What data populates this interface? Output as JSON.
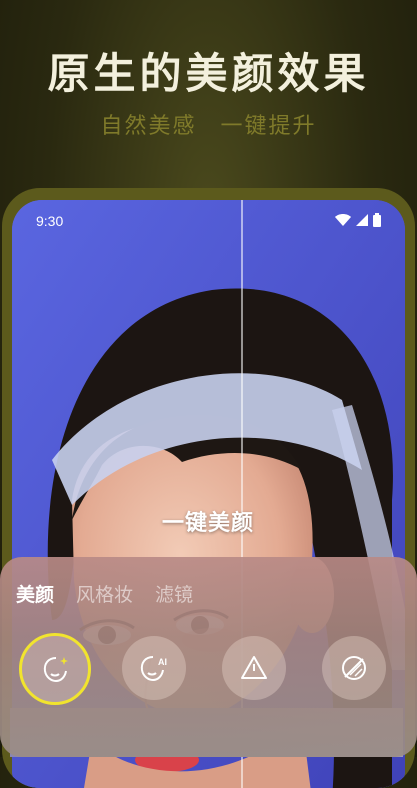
{
  "promo": {
    "headline": "原生的美颜效果",
    "subline": "自然美感　一键提升"
  },
  "status_bar": {
    "time": "9:30",
    "icons": [
      "wifi-icon",
      "cellular-icon",
      "battery-icon"
    ]
  },
  "preview": {
    "compare_label": "一键美颜"
  },
  "panel": {
    "tabs": [
      {
        "label": "美颜",
        "active": true
      },
      {
        "label": "风格妆",
        "active": false
      },
      {
        "label": "滤镜",
        "active": false
      }
    ],
    "tools": [
      {
        "icon": "face-sparkle-icon",
        "selected": true
      },
      {
        "icon": "face-ai-icon",
        "selected": false
      },
      {
        "icon": "triangle-icon",
        "selected": false
      },
      {
        "icon": "no-filter-icon",
        "selected": false
      }
    ]
  },
  "colors": {
    "accent": "#f1e42e",
    "background": "#2a2910",
    "phone_frame": "#5c5a1c",
    "subline": "#7f7a2a"
  }
}
